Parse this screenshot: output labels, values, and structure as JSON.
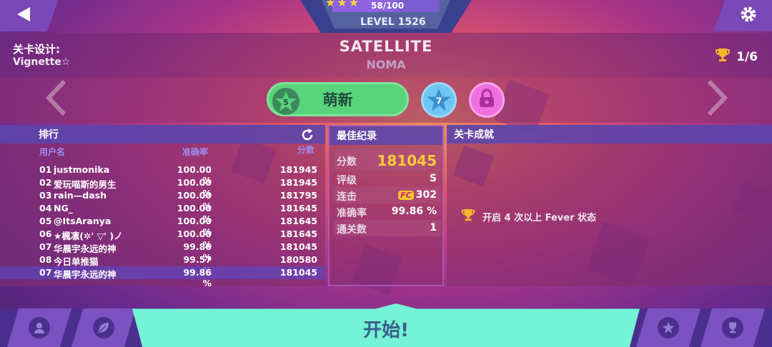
{
  "top_bar": {
    "progress": "58/100",
    "progress_fraction": 0.58,
    "stars": "★★★",
    "level": "LEVEL 1526"
  },
  "header": {
    "designer_label": "关卡设计:",
    "designer_name": "Vignette☆",
    "song_title": "SATELLITE",
    "song_artist": "NOMA",
    "trophy_count": "1/6"
  },
  "difficulty": {
    "main_level": "5",
    "main_label": "萌新",
    "blue_level": "7"
  },
  "ranking": {
    "title": "排行",
    "col_user": "用户名",
    "col_acc": "准确率",
    "col_score": "分数",
    "rows": [
      {
        "no": "01",
        "name": "justmonika",
        "acc": "100.00 %",
        "score": "181945"
      },
      {
        "no": "02",
        "name": "爱玩喵斯的男生",
        "acc": "100.00 %",
        "score": "181945"
      },
      {
        "no": "03",
        "name": "rain—dash",
        "acc": "100.00 %",
        "score": "181795"
      },
      {
        "no": "04",
        "name": "NG_",
        "acc": "100.00 %",
        "score": "181645"
      },
      {
        "no": "05",
        "name": "@ItsAranya",
        "acc": "100.00 %",
        "score": "181645"
      },
      {
        "no": "06",
        "name": "★楓凛(✲' ▽' )ノ",
        "acc": "100.00 %",
        "score": "181645"
      },
      {
        "no": "07",
        "name": "华晨宇永远的神",
        "acc": "99.86 %",
        "score": "181045"
      },
      {
        "no": "08",
        "name": "今日单推猫",
        "acc": "99.57 %",
        "score": "180580"
      }
    ],
    "mine": {
      "no": "07",
      "name": "华晨宇永远的神",
      "acc": "99.86 %",
      "score": "181045"
    }
  },
  "best": {
    "title": "最佳纪录",
    "score_label": "分数",
    "score": "181045",
    "grade_label": "评级",
    "grade": "S",
    "combo_label": "连击",
    "fc": "FC",
    "combo": "302",
    "acc_label": "准确率",
    "acc": "99.86 %",
    "clear_label": "通关数",
    "clear": "1"
  },
  "achievements": {
    "title": "关卡成就",
    "item": "开启 4 次以上 Fever 状态"
  },
  "bottom": {
    "start": "开始!"
  }
}
